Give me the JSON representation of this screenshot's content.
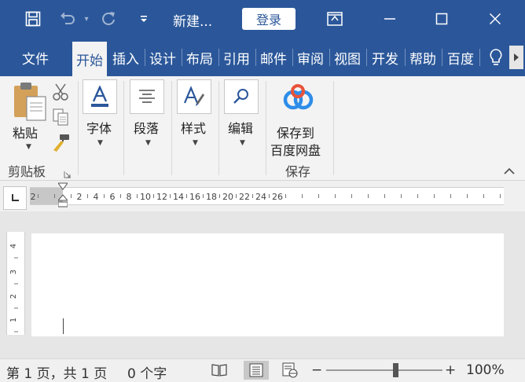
{
  "titlebar": {
    "doc_title": "新建...",
    "login_label": "登录",
    "qat_dropdown_glyph": "▾",
    "background": "#2b579a"
  },
  "tabs": [
    {
      "label": "文件"
    },
    {
      "label": "开始"
    },
    {
      "label": "插入"
    },
    {
      "label": "设计"
    },
    {
      "label": "布局"
    },
    {
      "label": "引用"
    },
    {
      "label": "邮件"
    },
    {
      "label": "审阅"
    },
    {
      "label": "视图"
    },
    {
      "label": "开发"
    },
    {
      "label": "帮助"
    },
    {
      "label": "百度"
    }
  ],
  "ribbon": {
    "clipboard": {
      "paste_label": "粘贴",
      "group_label": "剪贴板"
    },
    "font": {
      "label": "字体"
    },
    "paragraph": {
      "label": "段落"
    },
    "styles": {
      "label": "样式"
    },
    "editing": {
      "label": "编辑"
    },
    "baidu": {
      "line1": "保存到",
      "line2": "百度网盘",
      "group_label": "保存"
    }
  },
  "ruler": {
    "labels": [
      "2",
      "2",
      "4",
      "6",
      "8",
      "10",
      "12",
      "14",
      "16",
      "18",
      "20",
      "22",
      "24",
      "26"
    ],
    "vertical_labels": [
      "4",
      "3",
      "2",
      "1"
    ]
  },
  "statusbar": {
    "page_info": "第 1 页，共 1 页",
    "word_count": "0 个字",
    "zoom_minus": "−",
    "zoom_plus": "+",
    "zoom_level": "100%",
    "zoom_fraction": 0.6
  },
  "colors": {
    "accent": "#2b579a",
    "baidu_blue": "#2e8de8",
    "baidu_red": "#e8533a"
  }
}
